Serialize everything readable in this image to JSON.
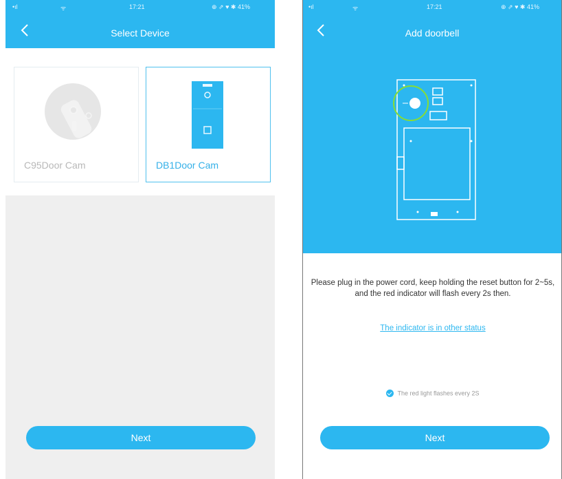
{
  "left_screen": {
    "status_bar": {
      "carrier": "•ıl",
      "wifi": "ᯤ",
      "time": "17:21",
      "right": "⊕ ⇗ ♥ ✱ 41%"
    },
    "title": "Select Device",
    "devices": [
      {
        "name": "C95Door Cam",
        "selected": false
      },
      {
        "name": "DB1Door Cam",
        "selected": true
      }
    ],
    "next_label": "Next"
  },
  "right_screen": {
    "status_bar": {
      "carrier": "•ıl",
      "wifi": "ᯤ",
      "time": "17:21",
      "right": "⊕ ⇗ ♥ ✱ 41%"
    },
    "title": "Add doorbell",
    "instruction": "Please plug in the power cord, keep holding the reset button for 2~5s, and the red indicator will flash every 2s then.",
    "other_status_link": "The indicator is in other status",
    "confirm_label": "The red light flashes every 2S",
    "confirm_checked": true,
    "next_label": "Next"
  },
  "colors": {
    "accent": "#2cb7f0",
    "background_gray": "#efefef"
  }
}
